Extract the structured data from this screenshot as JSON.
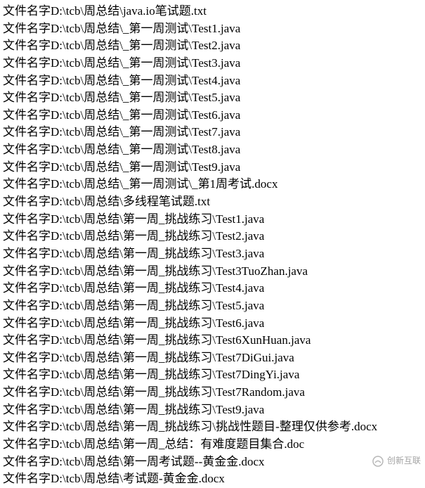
{
  "prefix": "文件名字",
  "lines": [
    "D:\\tcb\\周总结\\java.io笔试题.txt",
    "D:\\tcb\\周总结\\_第一周测试\\Test1.java",
    "D:\\tcb\\周总结\\_第一周测试\\Test2.java",
    "D:\\tcb\\周总结\\_第一周测试\\Test3.java",
    "D:\\tcb\\周总结\\_第一周测试\\Test4.java",
    "D:\\tcb\\周总结\\_第一周测试\\Test5.java",
    "D:\\tcb\\周总结\\_第一周测试\\Test6.java",
    "D:\\tcb\\周总结\\_第一周测试\\Test7.java",
    "D:\\tcb\\周总结\\_第一周测试\\Test8.java",
    "D:\\tcb\\周总结\\_第一周测试\\Test9.java",
    "D:\\tcb\\周总结\\_第一周测试\\_第1周考试.docx",
    "D:\\tcb\\周总结\\多线程笔试题.txt",
    "D:\\tcb\\周总结\\第一周_挑战练习\\Test1.java",
    "D:\\tcb\\周总结\\第一周_挑战练习\\Test2.java",
    "D:\\tcb\\周总结\\第一周_挑战练习\\Test3.java",
    "D:\\tcb\\周总结\\第一周_挑战练习\\Test3TuoZhan.java",
    "D:\\tcb\\周总结\\第一周_挑战练习\\Test4.java",
    "D:\\tcb\\周总结\\第一周_挑战练习\\Test5.java",
    "D:\\tcb\\周总结\\第一周_挑战练习\\Test6.java",
    "D:\\tcb\\周总结\\第一周_挑战练习\\Test6XunHuan.java",
    "D:\\tcb\\周总结\\第一周_挑战练习\\Test7DiGui.java",
    "D:\\tcb\\周总结\\第一周_挑战练习\\Test7DingYi.java",
    "D:\\tcb\\周总结\\第一周_挑战练习\\Test7Random.java",
    "D:\\tcb\\周总结\\第一周_挑战练习\\Test9.java",
    "D:\\tcb\\周总结\\第一周_挑战练习\\挑战性题目-整理仅供参考.docx",
    "D:\\tcb\\周总结\\第一周_总结：有难度题目集合.doc",
    "D:\\tcb\\周总结\\第一周考试题--黄金金.docx",
    "D:\\tcb\\周总结\\考试题-黄金金.docx"
  ],
  "watermark": {
    "brand": "创新互联"
  }
}
